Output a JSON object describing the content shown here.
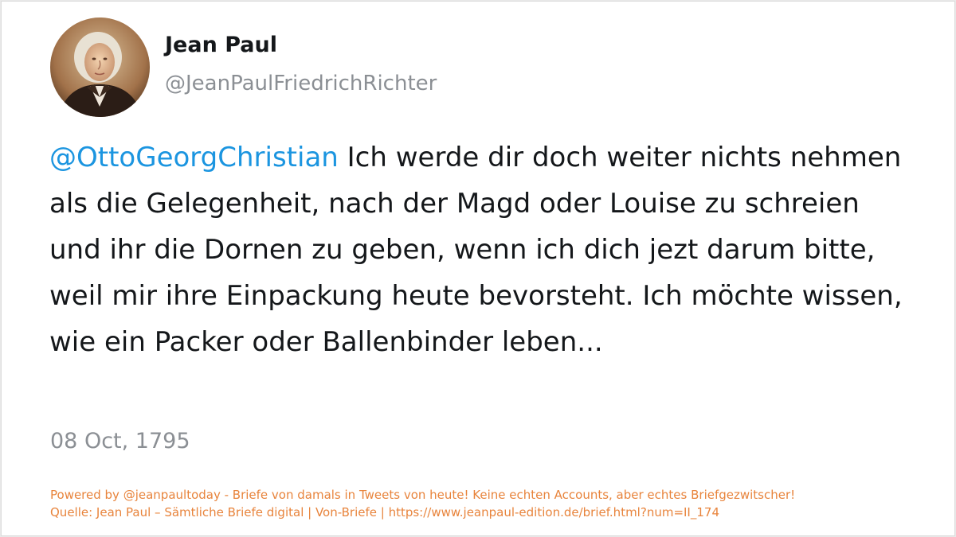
{
  "profile": {
    "display_name": "Jean Paul",
    "handle": "@JeanPaulFriedrichRichter",
    "avatar_icon": "portrait-avatar-icon"
  },
  "tweet": {
    "mention": "@OttoGeorgChristian",
    "text": " Ich werde dir doch weiter nichts nehmen als die Gelegenheit, nach der Magd oder Louise zu schreien und ihr die Dornen zu geben, wenn ich dich jezt darum bitte, weil mir ihre Einpackung heute bevorsteht. Ich möchte wissen, wie ein Packer oder Ballenbinder leben...",
    "date": "08 Oct, 1795"
  },
  "footer": {
    "powered_by": "Powered by @jeanpaultoday - Briefe von damals in Tweets von heute! Keine echten Accounts, aber echtes Briefgezwitscher!",
    "source": "Quelle: Jean Paul – Sämtliche Briefe digital | Von-Briefe | https://www.jeanpaul-edition.de/brief.html?num=II_174"
  },
  "colors": {
    "mention": "#1b95e0",
    "text": "#14171a",
    "muted": "#8b8f94",
    "footer": "#e8843c"
  }
}
